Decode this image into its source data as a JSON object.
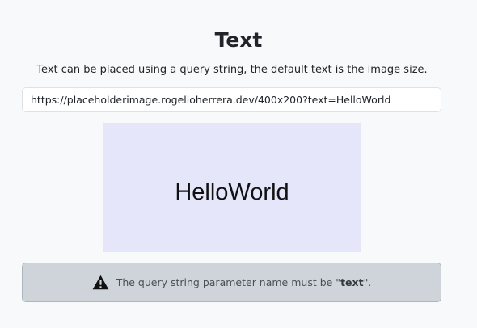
{
  "section": {
    "title": "Text",
    "description": "Text can be placed using a query string, the default text is the image size.",
    "url_value": "https://placeholderimage.rogelioherrera.dev/400x200?text=HelloWorld",
    "preview_text": "HelloWorld",
    "preview_background": "#e6e6fa",
    "alert": {
      "icon": "warning-triangle-icon",
      "prefix": "The query string parameter name must be \"",
      "param": "text",
      "suffix": "\"."
    }
  }
}
